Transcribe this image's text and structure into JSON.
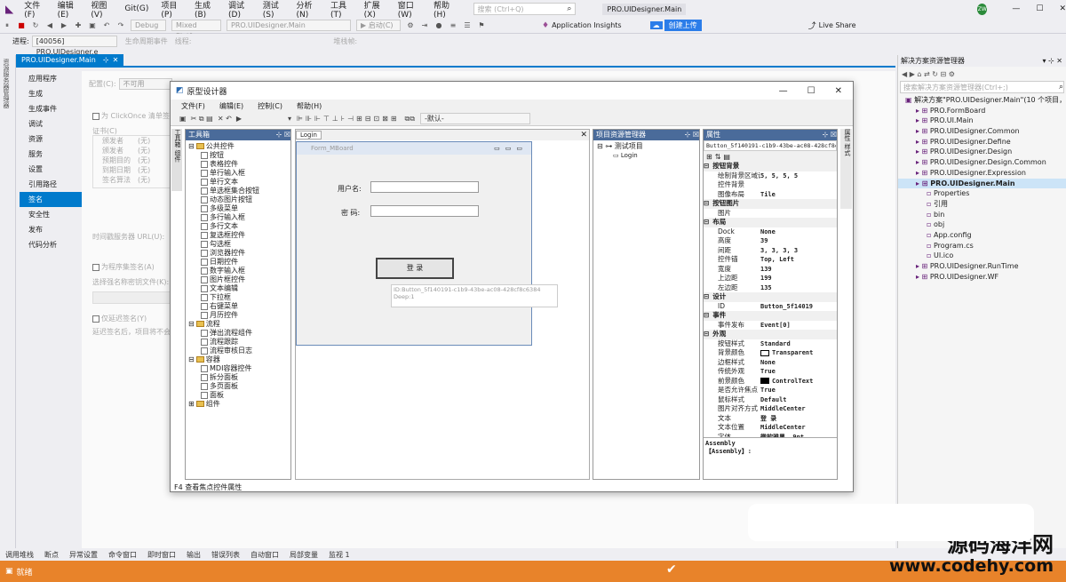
{
  "menu": [
    "文件(F)",
    "编辑(E)",
    "视图(V)",
    "Git(G)",
    "项目(P)",
    "生成(B)",
    "调试(D)",
    "测试(S)",
    "分析(N)",
    "工具(T)",
    "扩展(X)",
    "窗口(W)",
    "帮助(H)"
  ],
  "search_placeholder": "搜索 (Ctrl+Q)",
  "window_title": "PRO.UIDesigner.Main",
  "avatar": "ZW",
  "toolbar": {
    "debug": "Debug",
    "platform": "Mixed Platform",
    "startup": "PRO.UIDesigner.Main",
    "start": "▶ 启动(C)",
    "insights": "Application Insights",
    "upload": "创建上传",
    "liveshare": "Live Share"
  },
  "toolbar2": {
    "process_label": "进程:",
    "process": "[40056] PRO.UIDesigner.e",
    "lifecycle": "生命周期事件",
    "thread": "线程:",
    "stack": "堆栈帧:"
  },
  "sidebar_left": "资源服务器管理器",
  "doc_tab": "PRO.UIDesigner.Main",
  "projnav": [
    "应用程序",
    "生成",
    "生成事件",
    "调试",
    "资源",
    "服务",
    "设置",
    "引用路径",
    "签名",
    "安全性",
    "发布",
    "代码分析"
  ],
  "projnav_selected": 8,
  "ghost": {
    "config_label": "配置(C):",
    "config_value": "不可用",
    "clickonce": "为 ClickOnce 清单签名",
    "cert": "证书(C)",
    "cert_rows": [
      "颁发者",
      "颁发者",
      "预期目的",
      "到期日期",
      "签名算法"
    ],
    "cert_vals": [
      "(无)",
      "(无)",
      "(无)",
      "(无)",
      "(无)"
    ],
    "ts": "时间戳服务器 URL(U):",
    "sign_assembly": "为程序集签名(A)",
    "key": "选择强名称密钥文件(K):",
    "delay": "仅延迟签名(Y)",
    "note": "延迟签名后，项目将不会运行"
  },
  "solution": {
    "title": "解决方案资源管理器",
    "search": "搜索解决方案资源管理器(Ctrl+;)",
    "items": [
      {
        "t": "解决方案\"PRO.UIDesigner.Main\"(10 个项目，共",
        "i": 0
      },
      {
        "t": "PRO.FormBoard",
        "i": 1
      },
      {
        "t": "PRO.UI.Main",
        "i": 1
      },
      {
        "t": "PRO.UIDesigner.Common",
        "i": 1
      },
      {
        "t": "PRO.UIDesigner.Define",
        "i": 1
      },
      {
        "t": "PRO.UIDesigner.Design",
        "i": 1
      },
      {
        "t": "PRO.UIDesigner.Design.Common",
        "i": 1
      },
      {
        "t": "PRO.UIDesigner.Expression",
        "i": 1
      },
      {
        "t": "PRO.UIDesigner.Main",
        "i": 1,
        "sel": true
      },
      {
        "t": "Properties",
        "i": 2
      },
      {
        "t": "引用",
        "i": 2
      },
      {
        "t": "bin",
        "i": 2
      },
      {
        "t": "obj",
        "i": 2
      },
      {
        "t": "App.config",
        "i": 2
      },
      {
        "t": "Program.cs",
        "i": 2
      },
      {
        "t": "UI.ico",
        "i": 2
      },
      {
        "t": "PRO.UIDesigner.RunTime",
        "i": 1
      },
      {
        "t": "PRO.UIDesigner.WF",
        "i": 1
      }
    ]
  },
  "status_tabs": [
    "调用堆栈",
    "断点",
    "异常设置",
    "命令窗口",
    "即时窗口",
    "输出",
    "错误列表",
    "自动窗口",
    "局部变量",
    "监视 1"
  ],
  "status": "就绪",
  "watermark": {
    "cn": "源码海洋网",
    "url": "www.codehy.com"
  },
  "dlg": {
    "title": "原型设计器",
    "menu": [
      "文件(F)",
      "编辑(E)",
      "控制(C)",
      "帮助(H)"
    ],
    "combo": "-默认-",
    "toolbox": "工具箱",
    "tab_login": "Login",
    "form_title": "Form_MBoard",
    "user_label": "用户名:",
    "pwd_label": "密  码:",
    "login_btn": "登 录",
    "tooltip1": "ID:Button_5f140191-c1b9-43be-ac08-428cf8c6384",
    "tooltip2": "Deep:1",
    "resmgr": "项目资源管理器",
    "res_root": "测试项目",
    "res_child": "Login",
    "props": "属性",
    "props_obj": "Button_5f140191-c1b9-43be-ac08-428cf8c6384",
    "assembly_title": "Assembly",
    "assembly_value": "【Assembly】:",
    "status": "F4 查看焦点控件属性",
    "toolbox_tree": [
      {
        "t": "公共控件",
        "lv": 0,
        "f": 1
      },
      {
        "t": "按钮",
        "lv": 1
      },
      {
        "t": "表格控件",
        "lv": 1
      },
      {
        "t": "单行输入框",
        "lv": 1
      },
      {
        "t": "单行文本",
        "lv": 1
      },
      {
        "t": "单选框集合按钮",
        "lv": 1
      },
      {
        "t": "动态图片按钮",
        "lv": 1
      },
      {
        "t": "多级菜单",
        "lv": 1
      },
      {
        "t": "多行输入框",
        "lv": 1
      },
      {
        "t": "多行文本",
        "lv": 1
      },
      {
        "t": "复选框控件",
        "lv": 1
      },
      {
        "t": "勾选框",
        "lv": 1
      },
      {
        "t": "浏览器控件",
        "lv": 1
      },
      {
        "t": "日期控件",
        "lv": 1
      },
      {
        "t": "数字输入框",
        "lv": 1
      },
      {
        "t": "图片框控件",
        "lv": 1
      },
      {
        "t": "文本编辑",
        "lv": 1
      },
      {
        "t": "下拉框",
        "lv": 1
      },
      {
        "t": "右键菜单",
        "lv": 1
      },
      {
        "t": "月历控件",
        "lv": 1
      },
      {
        "t": "流程",
        "lv": 0,
        "f": 1
      },
      {
        "t": "弹出流程组件",
        "lv": 1
      },
      {
        "t": "流程跟踪",
        "lv": 1
      },
      {
        "t": "流程审核日志",
        "lv": 1
      },
      {
        "t": "容器",
        "lv": 0,
        "f": 1
      },
      {
        "t": "MDI容器控件",
        "lv": 1
      },
      {
        "t": "拆分面板",
        "lv": 1
      },
      {
        "t": "多页面板",
        "lv": 1
      },
      {
        "t": "面板",
        "lv": 1
      },
      {
        "t": "组件",
        "lv": 0,
        "f": 1
      }
    ],
    "props_rows": [
      {
        "c": "按钮背景"
      },
      {
        "k": "绘制背景区域设置",
        "v": "5, 5, 5, 5"
      },
      {
        "k": "控件背景",
        "v": ""
      },
      {
        "k": "图像布局",
        "v": "Tile"
      },
      {
        "c": "按钮图片"
      },
      {
        "k": "图片",
        "v": ""
      },
      {
        "c": "布局"
      },
      {
        "k": "Dock",
        "v": "None"
      },
      {
        "k": "高度",
        "v": "39"
      },
      {
        "k": "间距",
        "v": "3, 3, 3, 3"
      },
      {
        "k": "控件锚",
        "v": "Top, Left"
      },
      {
        "k": "宽度",
        "v": "139"
      },
      {
        "k": "上边距",
        "v": "199"
      },
      {
        "k": "左边距",
        "v": "135"
      },
      {
        "c": "设计"
      },
      {
        "k": "ID",
        "v": "Button_5f14019"
      },
      {
        "c": "事件"
      },
      {
        "k": "事件发布",
        "v": "Event[0]"
      },
      {
        "c": "外观"
      },
      {
        "k": "按钮样式",
        "v": "Standard"
      },
      {
        "k": "背景颜色",
        "v": "Transparent",
        "sw": "#ffffff"
      },
      {
        "k": "边框样式",
        "v": "None"
      },
      {
        "k": "传统外观",
        "v": "True"
      },
      {
        "k": "前景颜色",
        "v": "ControlText",
        "sw": "#000000"
      },
      {
        "k": "是否允许焦点",
        "v": "True"
      },
      {
        "k": "鼠标样式",
        "v": "Default"
      },
      {
        "k": "图片对齐方式",
        "v": "MiddleCenter"
      },
      {
        "k": "文本",
        "v": "登 录"
      },
      {
        "k": "文本位置",
        "v": "MiddleCenter"
      },
      {
        "k": "字体",
        "v": "微软雅黑, 9pt"
      }
    ]
  }
}
